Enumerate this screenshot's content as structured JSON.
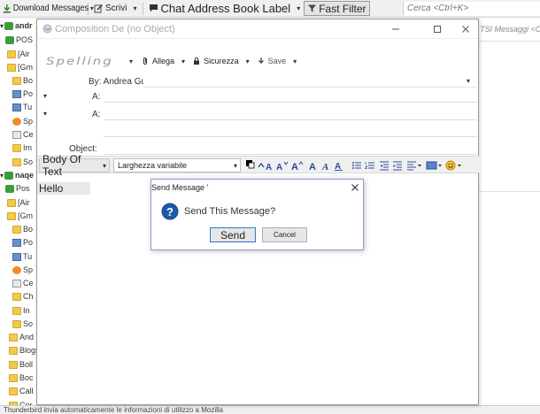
{
  "main_toolbar": {
    "download_label": "Download Messages",
    "write_label": "Scrivi",
    "chat_label": "Chat Address Book Label",
    "filter_label": "Fast Filter",
    "search_placeholder": "Cerca <Ctrl+K>"
  },
  "folder_pane": {
    "items": [
      {
        "label": "andr",
        "icon": "account-icon"
      },
      {
        "label": "POS",
        "icon": "download-icon"
      },
      {
        "label": "[Air",
        "icon": "folder-icon"
      },
      {
        "label": "[Gm",
        "icon": "folder-icon"
      },
      {
        "label": "Bo",
        "icon": "folder-icon"
      },
      {
        "label": "Po",
        "icon": "inbox-icon"
      },
      {
        "label": "Tu",
        "icon": "inbox-icon"
      },
      {
        "label": "Sp",
        "icon": "junk-icon"
      },
      {
        "label": "Ce",
        "icon": "trash-icon"
      },
      {
        "label": "Im",
        "icon": "folder-icon"
      },
      {
        "label": "So",
        "icon": "folder-icon"
      },
      {
        "label": "naqe",
        "icon": "account-icon"
      },
      {
        "label": "Pos",
        "icon": "download-icon"
      },
      {
        "label": "[Air",
        "icon": "folder-icon"
      },
      {
        "label": "[Gm",
        "icon": "folder-icon"
      },
      {
        "label": "Bo",
        "icon": "folder-icon"
      },
      {
        "label": "Po",
        "icon": "inbox-icon"
      },
      {
        "label": "Tu",
        "icon": "inbox-icon"
      },
      {
        "label": "Sp",
        "icon": "junk-icon"
      },
      {
        "label": "Ce",
        "icon": "trash-icon"
      },
      {
        "label": "Ch",
        "icon": "folder-icon"
      },
      {
        "label": "In",
        "icon": "folder-icon"
      },
      {
        "label": "So",
        "icon": "folder-icon"
      },
      {
        "label": "And",
        "icon": "folder-icon"
      },
      {
        "label": "Blogs",
        "icon": "folder-icon"
      },
      {
        "label": "Boll",
        "icon": "folder-icon"
      },
      {
        "label": "Boc",
        "icon": "folder-icon"
      },
      {
        "label": "Call",
        "icon": "folder-icon"
      },
      {
        "label": "Cor",
        "icon": "folder-icon"
      }
    ]
  },
  "right_pane": {
    "header": "TSI Messaggi <Ctrl+"
  },
  "compose": {
    "title": "Composition De (no Object)",
    "toolbar": {
      "spelling_label": "Spelling",
      "attach_label": "Allega",
      "security_label": "Sicurezza",
      "save_label": "Save"
    },
    "from_label": "By: Andrea Guida",
    "to_label_1": "A:",
    "to_label_2": "A:",
    "subject_label": "Object:",
    "paragraph_format": "Body Of Text",
    "font_name": "Larghezza variabile",
    "body_text": "Hello"
  },
  "dialog": {
    "title": "Send Message '",
    "message": "Send This Message?",
    "send_label": "Send",
    "cancel_label": "Cancel"
  },
  "status_bar": {
    "text": "Thunderbird invia automaticamente le informazioni di utilizzo a Mozilla"
  },
  "colors": {
    "accent_blue": "#2f79d7",
    "question_icon": "#1e5aa8"
  }
}
